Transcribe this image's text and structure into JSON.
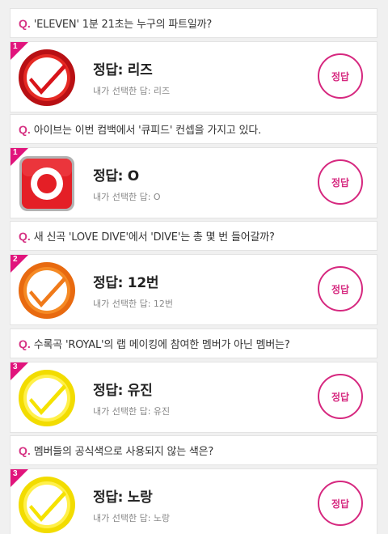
{
  "colors": {
    "accent": "#d6287f",
    "corner": "#e1147c"
  },
  "question_prefix": "Q.",
  "items": [
    {
      "number": "1",
      "question": "'ELEVEN' 1분 21초는 누구의 파트일까?",
      "answer_title": "정답: 리즈",
      "my_choice": "내가 선택한 답: 리즈",
      "button_label": "정답",
      "badge_icon": "red-ring-checkmark-icon"
    },
    {
      "number": "1",
      "question": "아이브는 이번 컴백에서 '큐피드' 컨셉을 가지고 있다.",
      "answer_title": "정답: O",
      "my_choice": "내가 선택한 답: O",
      "button_label": "정답",
      "badge_icon": "red-o-square-icon"
    },
    {
      "number": "2",
      "question": "새 신곡 'LOVE DIVE'에서 'DIVE'는 총 몇 번 들어갈까?",
      "answer_title": "정답: 12번",
      "my_choice": "내가 선택한 답: 12번",
      "button_label": "정답",
      "badge_icon": "orange-ring-checkmark-icon"
    },
    {
      "number": "3",
      "question": "수록곡 'ROYAL'의 랩 메이킹에 참여한 멤버가 아닌 멤버는?",
      "answer_title": "정답: 유진",
      "my_choice": "내가 선택한 답: 유진",
      "button_label": "정답",
      "badge_icon": "yellow-ring-checkmark-icon"
    },
    {
      "number": "3",
      "question": "멤버들의 공식색으로 사용되지 않는 색은?",
      "answer_title": "정답: 노랑",
      "my_choice": "내가 선택한 답: 노랑",
      "button_label": "정답",
      "badge_icon": "yellow-ring-checkmark-icon"
    }
  ]
}
